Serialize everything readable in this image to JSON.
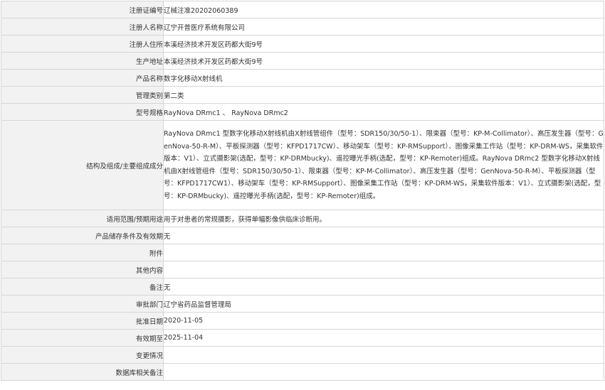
{
  "rows": [
    {
      "label": "注册证编号",
      "value": "辽械注准20202060389"
    },
    {
      "label": "注册人名称",
      "value": "辽宁开普医疗系统有限公司"
    },
    {
      "label": "注册人住所",
      "value": "本溪经济技术开发区药都大街9号"
    },
    {
      "label": "生产地址",
      "value": "本溪经济技术开发区药都大街9号"
    },
    {
      "label": "产品名称",
      "value": "数字化移动X射线机"
    },
    {
      "label": "管理类别",
      "value": "第二类"
    },
    {
      "label": "型号规格",
      "value": "RayNova DRmc1 、 RayNova DRmc2"
    },
    {
      "label": "结构及组成/主要组成成分",
      "value": "RayNova DRmc1 型数字化移动X射线机由X射线管组件（型号：SDR150/30/50-1）、限束器（型号：KP-M-Collimator）、高压发生器（型号：GenNova-50-R-M）、平板探测器（型号：KFPD1717CW）、移动架车（型号：KP-RMSupport）、图像采集工作站（型号：KP-DRM-WS，采集软件版本：V1）、立式摄影架(选配，型号：KP-DRMbucky)、遥控曝光手柄(选配，型号：KP-Remoter)组成。RayNova DRmc2 型数字化移动X射线机由X射线管组件（型号：SDR150/30/50-1）、限束器（型号：KP-M-Collimator）、高压发生器（型号：GenNova-50-R-M）、平板探测器（型号：KFPD1717CW1）、移动架车（型号：KP-RMSupport）、图像采集工作站（型号：KP-DRM-WS，采集软件版本：V1）、立式摄影架(选配，型号：KP-DRMbucky)、遥控曝光手柄(选配，型号：KP-Remoter)组成。"
    },
    {
      "label": "适用范围/预期用途",
      "value": "用于对患者的常规摄影，获得单幅影像供临床诊断用。"
    },
    {
      "label": "产品储存条件及有效期",
      "value": "无"
    },
    {
      "label": "附件",
      "value": ""
    },
    {
      "label": "其他内容",
      "value": ""
    },
    {
      "label": "备注",
      "value": "无"
    },
    {
      "label": "审批部门",
      "value": "辽宁省药品监督管理局"
    },
    {
      "label": "批准日期",
      "value": "2020-11-05"
    },
    {
      "label": "有效期至",
      "value": "2025-11-04"
    },
    {
      "label": "变更情况",
      "value": ""
    },
    {
      "label": "数据库相关备注",
      "value": ""
    }
  ]
}
